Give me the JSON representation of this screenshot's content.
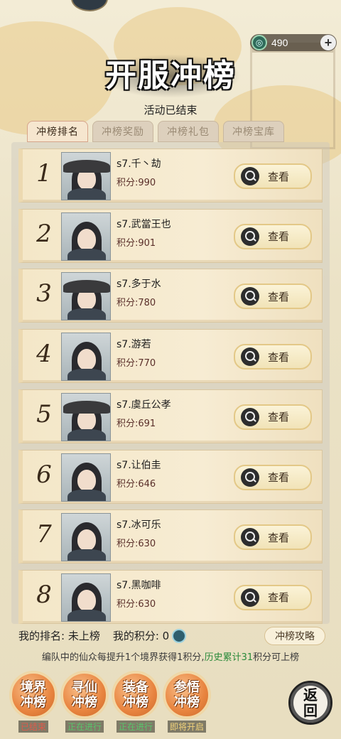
{
  "currency": {
    "amount": "490",
    "icon": "jade-spiral-icon",
    "add_icon": "plus-icon"
  },
  "header": {
    "title": "开服冲榜",
    "subtitle": "活动已结束"
  },
  "tabs": [
    {
      "label": "冲榜排名",
      "active": true
    },
    {
      "label": "冲榜奖励",
      "active": false
    },
    {
      "label": "冲榜礼包",
      "active": false
    },
    {
      "label": "冲榜宝库",
      "active": false
    }
  ],
  "rankings": [
    {
      "rank": "1",
      "name": "s7.千丶劫",
      "score": "积分:990"
    },
    {
      "rank": "2",
      "name": "s7.武當王也",
      "score": "积分:901"
    },
    {
      "rank": "3",
      "name": "s7.多于水",
      "score": "积分:780"
    },
    {
      "rank": "4",
      "name": "s7.游若",
      "score": "积分:770"
    },
    {
      "rank": "5",
      "name": "s7.虞丘公孝",
      "score": "积分:691"
    },
    {
      "rank": "6",
      "name": "s7.让伯圭",
      "score": "积分:646"
    },
    {
      "rank": "7",
      "name": "s7.冰可乐",
      "score": "积分:630"
    },
    {
      "rank": "8",
      "name": "s7.黑咖啡",
      "score": "积分:630"
    }
  ],
  "view_label": "查看",
  "footer": {
    "my_rank": "我的排名: 未上榜",
    "my_score": "我的积分: 0",
    "guide_label": "冲榜攻略",
    "info_a": "编队中的仙众每提升1个境界获得1积分,",
    "info_b": "历史累计31",
    "info_c": "积分可上榜"
  },
  "bottom_buttons": [
    {
      "label": "境界\n冲榜",
      "status": "已结束",
      "status_color": "#e05a4a"
    },
    {
      "label": "寻仙\n冲榜",
      "status": "正在进行",
      "status_color": "#58c46a"
    },
    {
      "label": "装备\n冲榜",
      "status": "正在进行",
      "status_color": "#58c46a"
    },
    {
      "label": "参悟\n冲榜",
      "status": "即将开启",
      "status_color": "#f0d27a"
    }
  ],
  "return_label": "返\n回"
}
